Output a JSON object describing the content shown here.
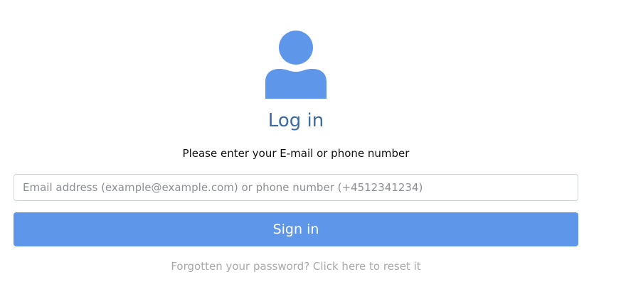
{
  "login": {
    "icon": "user-avatar-icon",
    "title": "Log in",
    "subtitle": "Please enter your E-mail or phone number",
    "identifier_input": {
      "value": "",
      "placeholder": "Email address (example@example.com) or phone number (+4512341234)"
    },
    "sign_in_label": "Sign in",
    "forgot_link": "Forgotten your password? Click here to reset it"
  },
  "colors": {
    "accent": "#5e96ea",
    "title": "#3d6aa0",
    "muted_link": "#a9a9a9"
  }
}
